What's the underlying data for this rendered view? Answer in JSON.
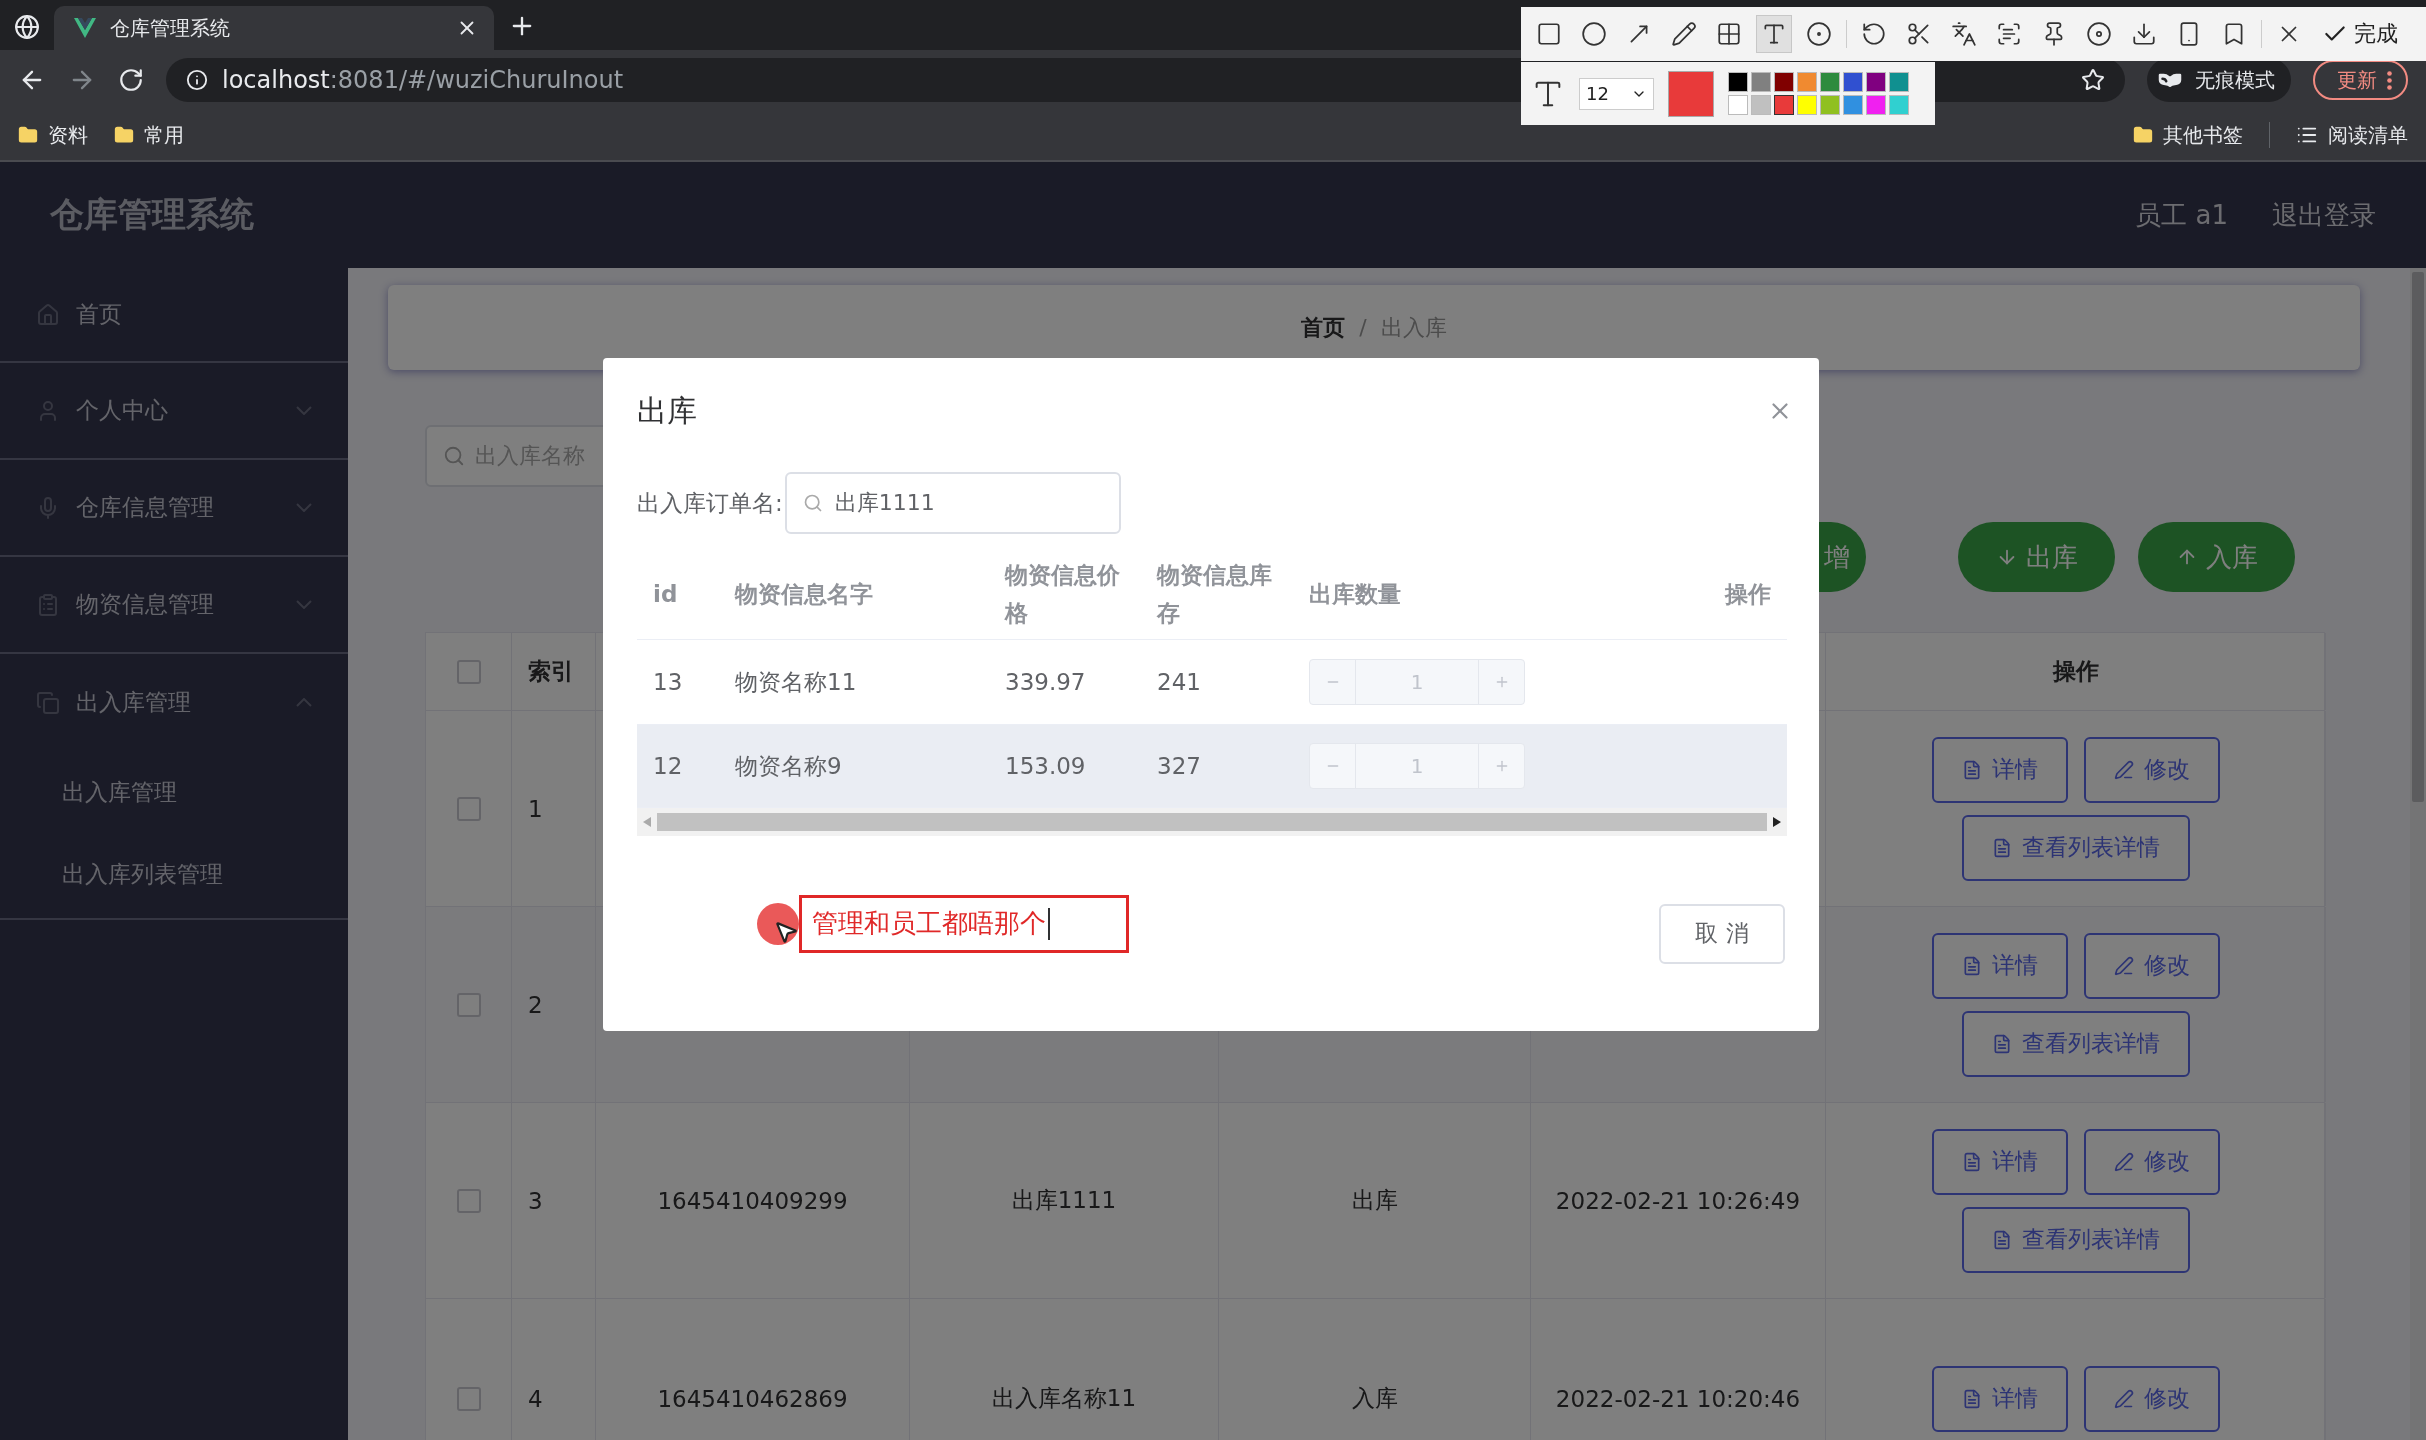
{
  "browser": {
    "tab_title": "仓库管理系统",
    "url_host": "localhost",
    "url_rest": ":8081/#/wuziChuruInout",
    "forward_disabled": true,
    "bookmarks": [
      "资料",
      "常用"
    ],
    "other_bookmarks": "其他书签",
    "reading_list": "阅读清单",
    "incognito": "无痕模式",
    "update": "更新"
  },
  "capture_toolbar": {
    "tools": [
      {
        "kind": "rectangle",
        "selected": false
      },
      {
        "kind": "ellipse",
        "selected": false
      },
      {
        "kind": "arrow",
        "selected": false
      },
      {
        "kind": "pencil",
        "selected": false
      },
      {
        "kind": "mosaic",
        "selected": false
      },
      {
        "kind": "text",
        "selected": true
      },
      {
        "kind": "number",
        "selected": false
      },
      {
        "kind": "undo",
        "selected": false
      },
      {
        "kind": "cut",
        "selected": false
      },
      {
        "kind": "translate",
        "selected": false
      },
      {
        "kind": "ocr",
        "selected": false
      },
      {
        "kind": "pin",
        "selected": false
      },
      {
        "kind": "record",
        "selected": false
      },
      {
        "kind": "download",
        "selected": false
      },
      {
        "kind": "phone",
        "selected": false
      },
      {
        "kind": "bookmark",
        "selected": false
      },
      {
        "kind": "close",
        "selected": false
      }
    ],
    "done": "完成",
    "font_size": "12",
    "palette": [
      {
        "color": "#000000",
        "selected": false
      },
      {
        "color": "#808080",
        "selected": false
      },
      {
        "color": "#800000",
        "selected": false
      },
      {
        "color": "#f08a30",
        "selected": false
      },
      {
        "color": "#2e8b3e",
        "selected": false
      },
      {
        "color": "#3050d0",
        "selected": false
      },
      {
        "color": "#800080",
        "selected": false
      },
      {
        "color": "#109090",
        "selected": false
      },
      {
        "color": "#ffffff",
        "selected": false
      },
      {
        "color": "#c0c0c0",
        "selected": false
      },
      {
        "color": "#e83a3a",
        "selected": true
      },
      {
        "color": "#ffff00",
        "selected": false
      },
      {
        "color": "#90c020",
        "selected": false
      },
      {
        "color": "#3090e0",
        "selected": false
      },
      {
        "color": "#f020f0",
        "selected": false
      },
      {
        "color": "#30d0d0",
        "selected": false
      }
    ]
  },
  "app": {
    "title": "仓库管理系统",
    "user": "员工 a1",
    "logout": "退出登录",
    "menu": [
      {
        "kind": "link",
        "label": "首页"
      },
      {
        "kind": "group",
        "label": "个人中心",
        "expanded": false
      },
      {
        "kind": "group",
        "label": "仓库信息管理",
        "expanded": false
      },
      {
        "kind": "group",
        "label": "物资信息管理",
        "expanded": false
      },
      {
        "kind": "group",
        "label": "出入库管理",
        "expanded": true,
        "children": [
          {
            "label": "出入库管理"
          },
          {
            "label": "出入库列表管理"
          }
        ]
      }
    ],
    "breadcrumb": [
      "首页",
      "出入库"
    ],
    "breadcrumb_separator": "/",
    "search_placeholder": "出入库名称",
    "actions": [
      {
        "kind": "add",
        "label": "增"
      },
      {
        "kind": "out",
        "label": "出库"
      },
      {
        "kind": "in",
        "label": "入库"
      }
    ],
    "table": {
      "columns": [
        "索引",
        "操作"
      ],
      "select_all": false,
      "rows": [
        {
          "index": "1",
          "checked": false,
          "actions": [
            "详情",
            "修改",
            "查看列表详情"
          ]
        },
        {
          "index": "2",
          "checked": false,
          "actions": [
            "详情",
            "修改",
            "查看列表详情"
          ]
        },
        {
          "index": "3",
          "checked": false,
          "cells": [
            "1645410409299",
            "出库1111",
            "出库",
            "2022-02-21 10:26:49"
          ],
          "actions": [
            "详情",
            "修改",
            "查看列表详情"
          ]
        },
        {
          "index": "4",
          "checked": false,
          "cells": [
            "1645410462869",
            "出入库名称11",
            "入库",
            "2022-02-21 10:20:46"
          ],
          "actions": [
            "详情",
            "修改"
          ]
        }
      ]
    }
  },
  "modal": {
    "title": "出库",
    "order_label": "出入库订单名:",
    "order_value": "出库1111",
    "columns": [
      "id",
      "物资信息名字",
      "物资信息价格",
      "物资信息库存",
      "出库数量",
      "操作"
    ],
    "rows": [
      {
        "id": "13",
        "name": "物资名称11",
        "price": "339.97",
        "stock": "241",
        "quantity": "1",
        "disabled": true,
        "hovered": false
      },
      {
        "id": "12",
        "name": "物资名称9",
        "price": "153.09",
        "stock": "327",
        "quantity": "1",
        "disabled": true,
        "hovered": true
      }
    ],
    "cancel": "取 消",
    "annotation": "管理和员工都唔那个"
  }
}
